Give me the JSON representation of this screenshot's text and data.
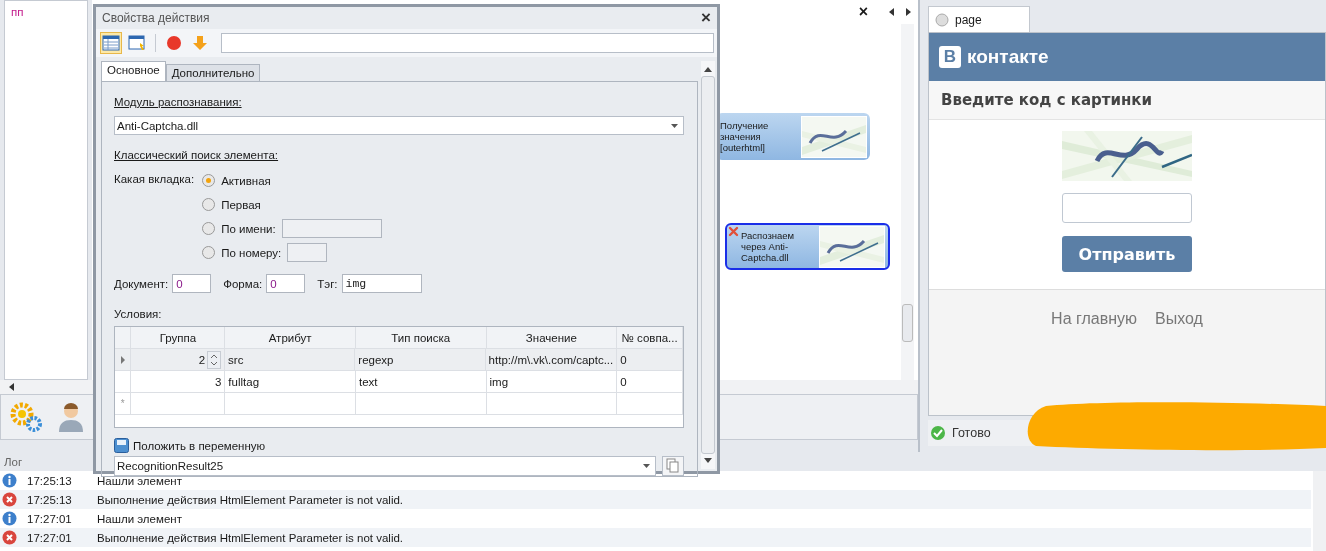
{
  "workspace": {
    "page_text": "пп"
  },
  "canvas": {
    "close": "×",
    "nodes": [
      {
        "text": "Получение значения [outerhtml]",
        "selected": false,
        "error": false
      },
      {
        "text": "Распознаем через Anti-Captcha.dll",
        "selected": true,
        "error": true
      }
    ]
  },
  "dialog": {
    "title": "Свойства действия",
    "close": "×",
    "toolbar": [
      {
        "kind": "table",
        "selected": true
      },
      {
        "kind": "window",
        "selected": false
      },
      {
        "kind": "stop",
        "selected": false
      },
      {
        "kind": "down",
        "selected": false
      }
    ],
    "tabs": [
      {
        "label": "Основное",
        "selected": true
      },
      {
        "label": "Дополнительно",
        "selected": false
      }
    ],
    "module_label": "Модуль распознавания:",
    "module_value": "Anti-Captcha.dll",
    "search_label": "Классический поиск элемента:",
    "tab_label": "Какая вкладка:",
    "radios": [
      {
        "label": "Активная",
        "selected": true,
        "kind": "plain"
      },
      {
        "label": "Первая",
        "selected": false,
        "kind": "plain"
      },
      {
        "label": "По имени:",
        "selected": false,
        "kind": "wide_field"
      },
      {
        "label": "По номеру:",
        "selected": false,
        "kind": "narrow_field"
      }
    ],
    "fields": [
      {
        "label": "Документ:",
        "value": "0",
        "kind": "number"
      },
      {
        "label": "Форма:",
        "value": "0",
        "kind": "number"
      },
      {
        "label": "Тэг:",
        "value": "img",
        "kind": "mono"
      }
    ],
    "conditions_label": "Условия:",
    "grid": {
      "columns": [
        "Группа",
        "Атрибут",
        "Тип поиска",
        "Значение",
        "№ совпа..."
      ],
      "rows": [
        {
          "selected": true,
          "cells": [
            "2",
            "src",
            "regexp",
            "http://m\\.vk\\.com/captc...",
            "0"
          ]
        },
        {
          "selected": false,
          "cells": [
            "3",
            "fulltag",
            "text",
            "img",
            "0"
          ]
        }
      ],
      "new_row_mark": "*"
    },
    "save_label": "Положить в переменную",
    "variable": "RecognitionResult25"
  },
  "browser": {
    "tab": "page",
    "logo_letter": "В",
    "logo_text": "контакте",
    "heading": "Введите код с картинки",
    "submit": "Отправить",
    "links": [
      "На главную",
      "Выход"
    ],
    "status": "Готово"
  },
  "log": {
    "title": "Лог",
    "entries": [
      {
        "kind": "info",
        "time": "17:25:13",
        "message": "Нашли элемент"
      },
      {
        "kind": "error",
        "time": "17:25:13",
        "message": "Выполнение действия HtmlElement Parameter is not valid."
      },
      {
        "kind": "info",
        "time": "17:27:01",
        "message": "Нашли элемент"
      },
      {
        "kind": "error",
        "time": "17:27:01",
        "message": "Выполнение действия HtmlElement Parameter is not valid."
      }
    ]
  }
}
